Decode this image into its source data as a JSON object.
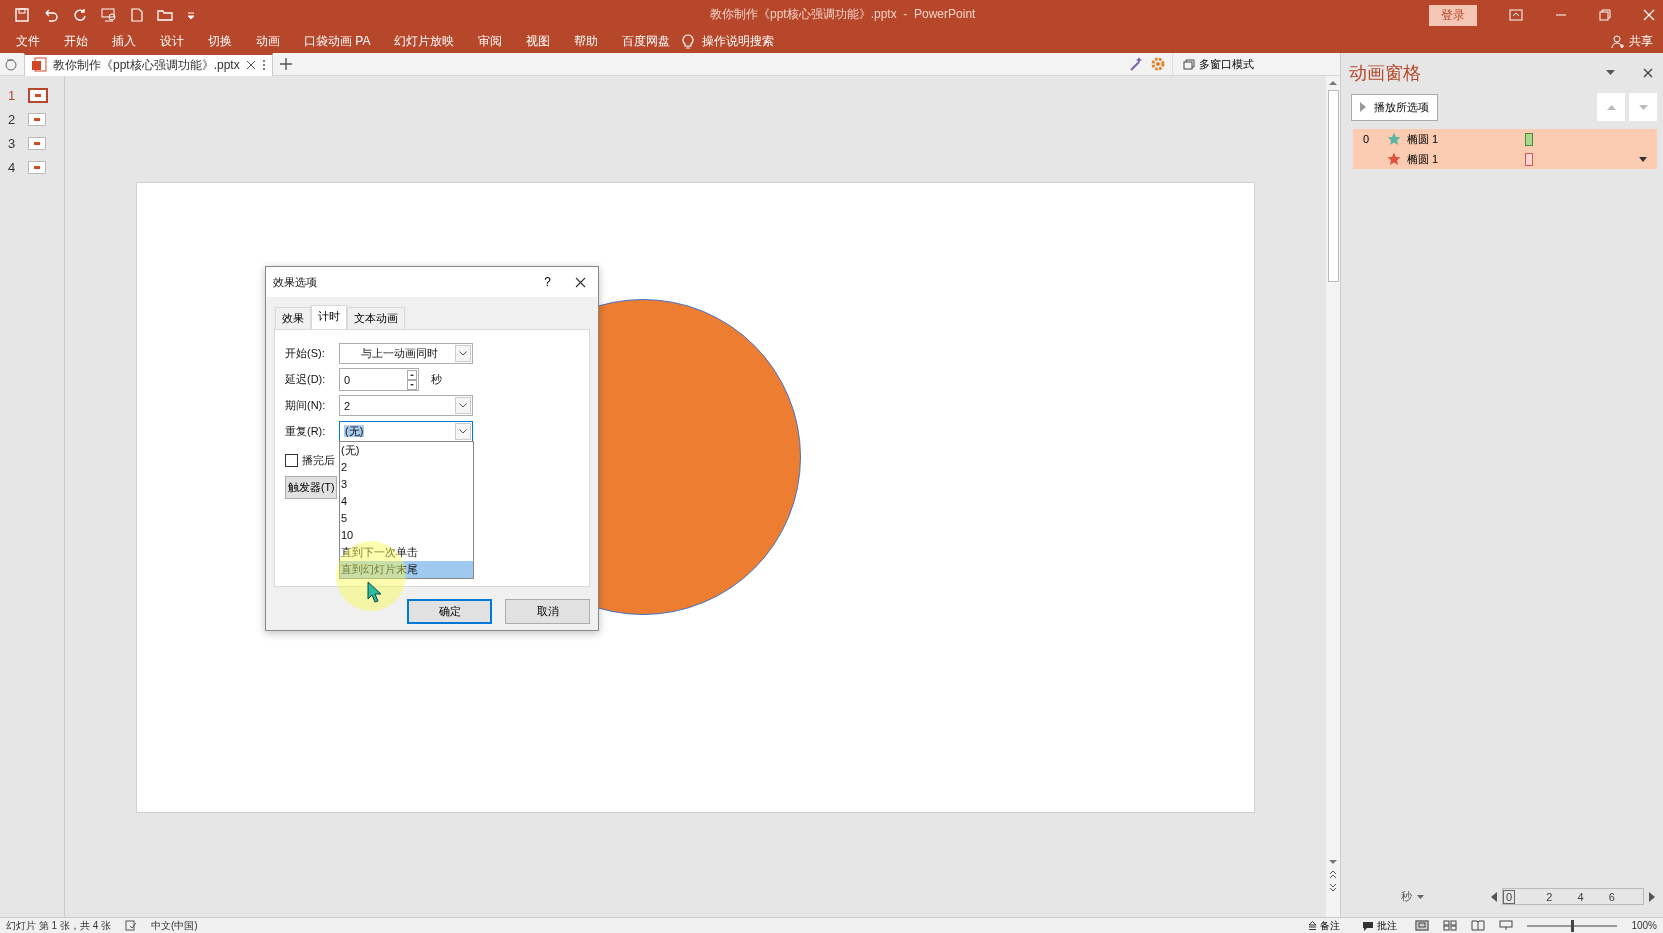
{
  "window": {
    "title": "教你制作《ppt核心强调功能》.pptx  -  PowerPoint",
    "login": "登录"
  },
  "ribbon": {
    "tabs": [
      {
        "label": "文件",
        "selected": false
      },
      {
        "label": "开始",
        "selected": false
      },
      {
        "label": "插入",
        "selected": false
      },
      {
        "label": "设计",
        "selected": false
      },
      {
        "label": "切换",
        "selected": false
      },
      {
        "label": "动画",
        "selected": false
      },
      {
        "label": "口袋动画 PA",
        "selected": false
      },
      {
        "label": "幻灯片放映",
        "selected": false
      },
      {
        "label": "审阅",
        "selected": false
      },
      {
        "label": "视图",
        "selected": false
      },
      {
        "label": "帮助",
        "selected": false
      },
      {
        "label": "百度网盘",
        "selected": false
      }
    ],
    "tell_me": "操作说明搜索",
    "share": "共享"
  },
  "doc_tabs": [
    {
      "label": "教你制作《ppt核心强调功能》.pptx",
      "selected": true
    }
  ],
  "multi_window": "多窗口模式",
  "slides": [
    {
      "number": "1",
      "selected": true
    },
    {
      "number": "2",
      "selected": false
    },
    {
      "number": "3",
      "selected": false
    },
    {
      "number": "4",
      "selected": false
    }
  ],
  "dialog": {
    "title": "效果选项",
    "help": "?",
    "tabs": [
      {
        "label": "效果",
        "selected": false
      },
      {
        "label": "计时",
        "selected": true
      },
      {
        "label": "文本动画",
        "selected": false
      }
    ],
    "fields": [
      {
        "kind": "dropdown",
        "label": "开始(S):",
        "value": "与上一动画同时"
      },
      {
        "kind": "spinner",
        "label": "延迟(D):",
        "value": "0",
        "unit": "秒"
      },
      {
        "kind": "dropdown",
        "label": "期间(N):",
        "value": "2"
      },
      {
        "kind": "dropdown",
        "label": "重复(R):",
        "value": "(无)"
      }
    ],
    "checkbox": {
      "label": "播完后",
      "checked": false
    },
    "trigger": "触发器(T)",
    "list": [
      {
        "label": "(无)",
        "selected": false
      },
      {
        "label": "2",
        "selected": false
      },
      {
        "label": "3",
        "selected": false
      },
      {
        "label": "4",
        "selected": false
      },
      {
        "label": "5",
        "selected": false
      },
      {
        "label": "10",
        "selected": false
      },
      {
        "label": "直到下一次单击",
        "selected": false
      },
      {
        "label": "直到幻灯片末尾",
        "selected": true
      }
    ],
    "buttons": [
      {
        "label": "确定",
        "kind": "default"
      },
      {
        "label": "取消",
        "kind": "normal"
      }
    ]
  },
  "animation_pane": {
    "title": "动画窗格",
    "play": "播放所选项",
    "items": [
      {
        "index": "0",
        "name": "椭圆 1",
        "kind": "entrance"
      },
      {
        "name": "椭圆 1",
        "kind": "exit"
      }
    ],
    "timeline": {
      "unit": "秒",
      "ticks": [
        "0",
        "2",
        "4",
        "6"
      ]
    }
  },
  "status_bar": {
    "slide": "幻灯片 第 1 张，共 4 张",
    "language": "中文(中国)",
    "notes": "备注",
    "comments": "批注",
    "zoom": "100%",
    "zoom_slider": {
      "level": 0.5
    }
  }
}
